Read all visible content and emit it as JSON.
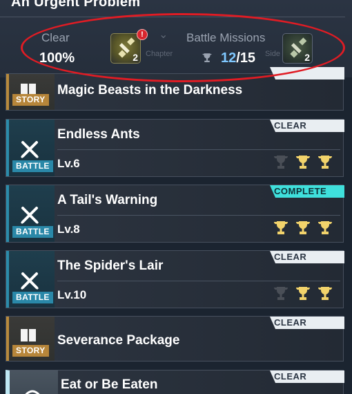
{
  "header": {
    "chapter_title": "An Urgent Problem",
    "clear_label": "Clear",
    "clear_value": "100%",
    "clear_reward": {
      "icon": "key-icon",
      "count": "2",
      "alert": "!"
    },
    "battle_missions_label": "Battle Missions",
    "battle_missions_done": "12",
    "battle_missions_sep": "/",
    "battle_missions_total": "15",
    "battle_reward": {
      "icon": "key-icon",
      "count": "2"
    },
    "faint_chapter": "Chapter",
    "faint_side": "Side"
  },
  "missions": [
    {
      "title": "Magic Beasts in the Darkness",
      "type": "STORY"
    },
    {
      "title": "Endless Ants",
      "type": "BATTLE",
      "level": "Lv.6",
      "status": "CLEAR",
      "trophies": [
        false,
        true,
        true
      ]
    },
    {
      "title": "A Tail's Warning",
      "type": "BATTLE",
      "level": "Lv.8",
      "status": "COMPLETE",
      "trophies": [
        true,
        true,
        true
      ]
    },
    {
      "title": "The Spider's Lair",
      "type": "BATTLE",
      "level": "Lv.10",
      "status": "CLEAR",
      "trophies": [
        false,
        true,
        true
      ]
    },
    {
      "title": "Severance Package",
      "type": "STORY",
      "status": "CLEAR"
    },
    {
      "title": "Eat or Be Eaten",
      "status": "CLEAR"
    }
  ],
  "colors": {
    "story_accent": "#b7863a",
    "battle_accent": "#2a88a8",
    "complete_tag": "#3fe0dc",
    "clear_tag": "#e9eef2",
    "trophy_gold": "#f2d36b",
    "trophy_empty": "#4a4f57",
    "highlight_ring": "#e01c24",
    "progress_blue": "#7fc8ff"
  }
}
